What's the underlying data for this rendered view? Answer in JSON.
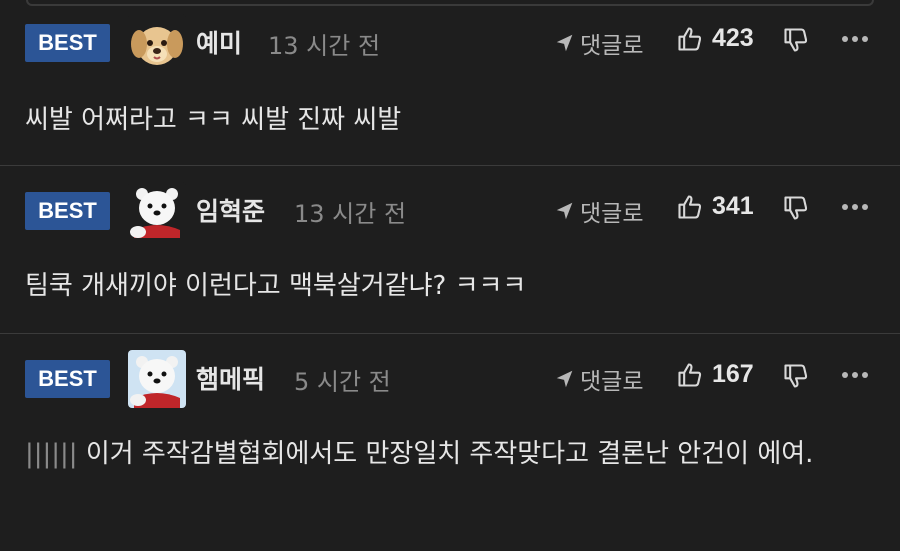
{
  "comments": [
    {
      "badge": "BEST",
      "author": "예미",
      "time": "13 시간 전",
      "reply_label": "댓글로",
      "upvotes": "423",
      "text": "씨발 어쩌라고 ㅋㅋ 씨발 진짜 씨발",
      "avatar": "puppy-avatar"
    },
    {
      "badge": "BEST",
      "author": "임혁준",
      "time": "13 시간 전",
      "reply_label": "댓글로",
      "upvotes": "341",
      "text": "팀쿡 개새끼야 이런다고 맥북살거같냐? ㅋㅋㅋ",
      "avatar": "polar-bear-avatar"
    },
    {
      "badge": "BEST",
      "author": "햄메픽",
      "time": "5 시간 전",
      "reply_label": "댓글로",
      "upvotes": "167",
      "quote_prefix": "||||||",
      "text": "이거 주작감별협회에서도 만장일치 주작맞다고 결론난 안건이 에여.",
      "avatar": "polar-bear-avatar"
    }
  ],
  "colors": {
    "background": "#1e1e1e",
    "badge": "#2c5596",
    "text": "#e6e6e6",
    "muted": "#8a8a8a"
  }
}
